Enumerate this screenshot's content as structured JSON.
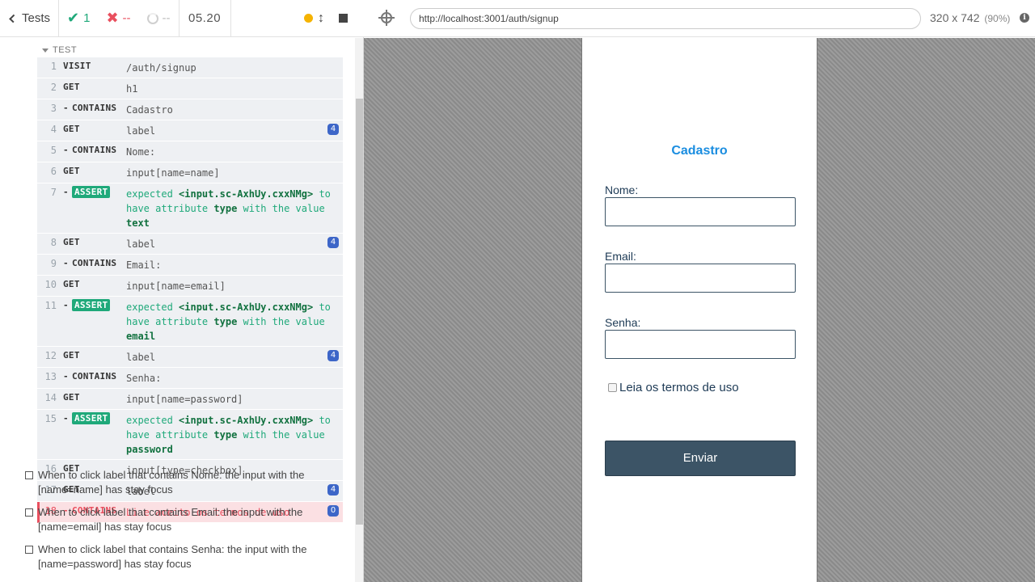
{
  "reporter": {
    "tests_label": "Tests",
    "passed": "1",
    "failed": "--",
    "pending": "--",
    "duration": "05.20",
    "test_title": "TEST",
    "commands": [
      {
        "n": "1",
        "name": "VISIT",
        "child": false,
        "msg": "/auth/signup"
      },
      {
        "n": "2",
        "name": "GET",
        "child": false,
        "msg": "h1"
      },
      {
        "n": "3",
        "name": "CONTAINS",
        "child": true,
        "msg": "Cadastro"
      },
      {
        "n": "4",
        "name": "GET",
        "child": false,
        "msg": "label",
        "badge": "4"
      },
      {
        "n": "5",
        "name": "CONTAINS",
        "child": true,
        "msg": "Nome:"
      },
      {
        "n": "6",
        "name": "GET",
        "child": false,
        "msg": "input[name=name]"
      },
      {
        "n": "7",
        "name": "ASSERT",
        "assert": true,
        "pre": "expected",
        "el": "<input.sc-AxhUy.cxxNMg>",
        "mid": "to have attribute",
        "attr": "type",
        "post": "with the value",
        "val": "text"
      },
      {
        "n": "8",
        "name": "GET",
        "child": false,
        "msg": "label",
        "badge": "4"
      },
      {
        "n": "9",
        "name": "CONTAINS",
        "child": true,
        "msg": "Email:"
      },
      {
        "n": "10",
        "name": "GET",
        "child": false,
        "msg": "input[name=email]"
      },
      {
        "n": "11",
        "name": "ASSERT",
        "assert": true,
        "pre": "expected",
        "el": "<input.sc-AxhUy.cxxNMg>",
        "mid": "to have attribute",
        "attr": "type",
        "post": "with the value",
        "val": "email"
      },
      {
        "n": "12",
        "name": "GET",
        "child": false,
        "msg": "label",
        "badge": "4"
      },
      {
        "n": "13",
        "name": "CONTAINS",
        "child": true,
        "msg": "Senha:"
      },
      {
        "n": "14",
        "name": "GET",
        "child": false,
        "msg": "input[name=password]"
      },
      {
        "n": "15",
        "name": "ASSERT",
        "assert": true,
        "pre": "expected",
        "el": "<input.sc-AxhUy.cxxNMg>",
        "mid": "to have attribute",
        "attr": "type",
        "post": "with the value",
        "val": "password"
      },
      {
        "n": "16",
        "name": "GET",
        "child": false,
        "msg": "input[type=checkbox]"
      },
      {
        "n": "17",
        "name": "GET",
        "child": false,
        "msg": "label",
        "badge": "4"
      },
      {
        "n": "18",
        "name": "CONTAINS",
        "child": true,
        "msg": "Li e aceito os termos de uso",
        "badge": "0",
        "failed": true
      }
    ],
    "pending_tests": [
      "When to click label that contains Nome: the input with the [name=name] has stay focus",
      "When to click label that contains Email: the input with the [name=email] has stay focus",
      "When to click label that contains Senha: the input with the [name=password] has stay focus"
    ]
  },
  "aut": {
    "url": "http://localhost:3001/auth/signup",
    "viewport_size": "320 x 742",
    "zoom": "(90%)",
    "info_icon": "i"
  },
  "app": {
    "title": "Cadastro",
    "name_label": "Nome:",
    "email_label": "Email:",
    "password_label": "Senha:",
    "checkbox_label": "Leia os termos de uso",
    "submit_label": "Enviar"
  },
  "colors": {
    "pass": "#1fa97a",
    "fail": "#e94f5e",
    "accent": "#1a8de0",
    "button": "#3c5466"
  }
}
